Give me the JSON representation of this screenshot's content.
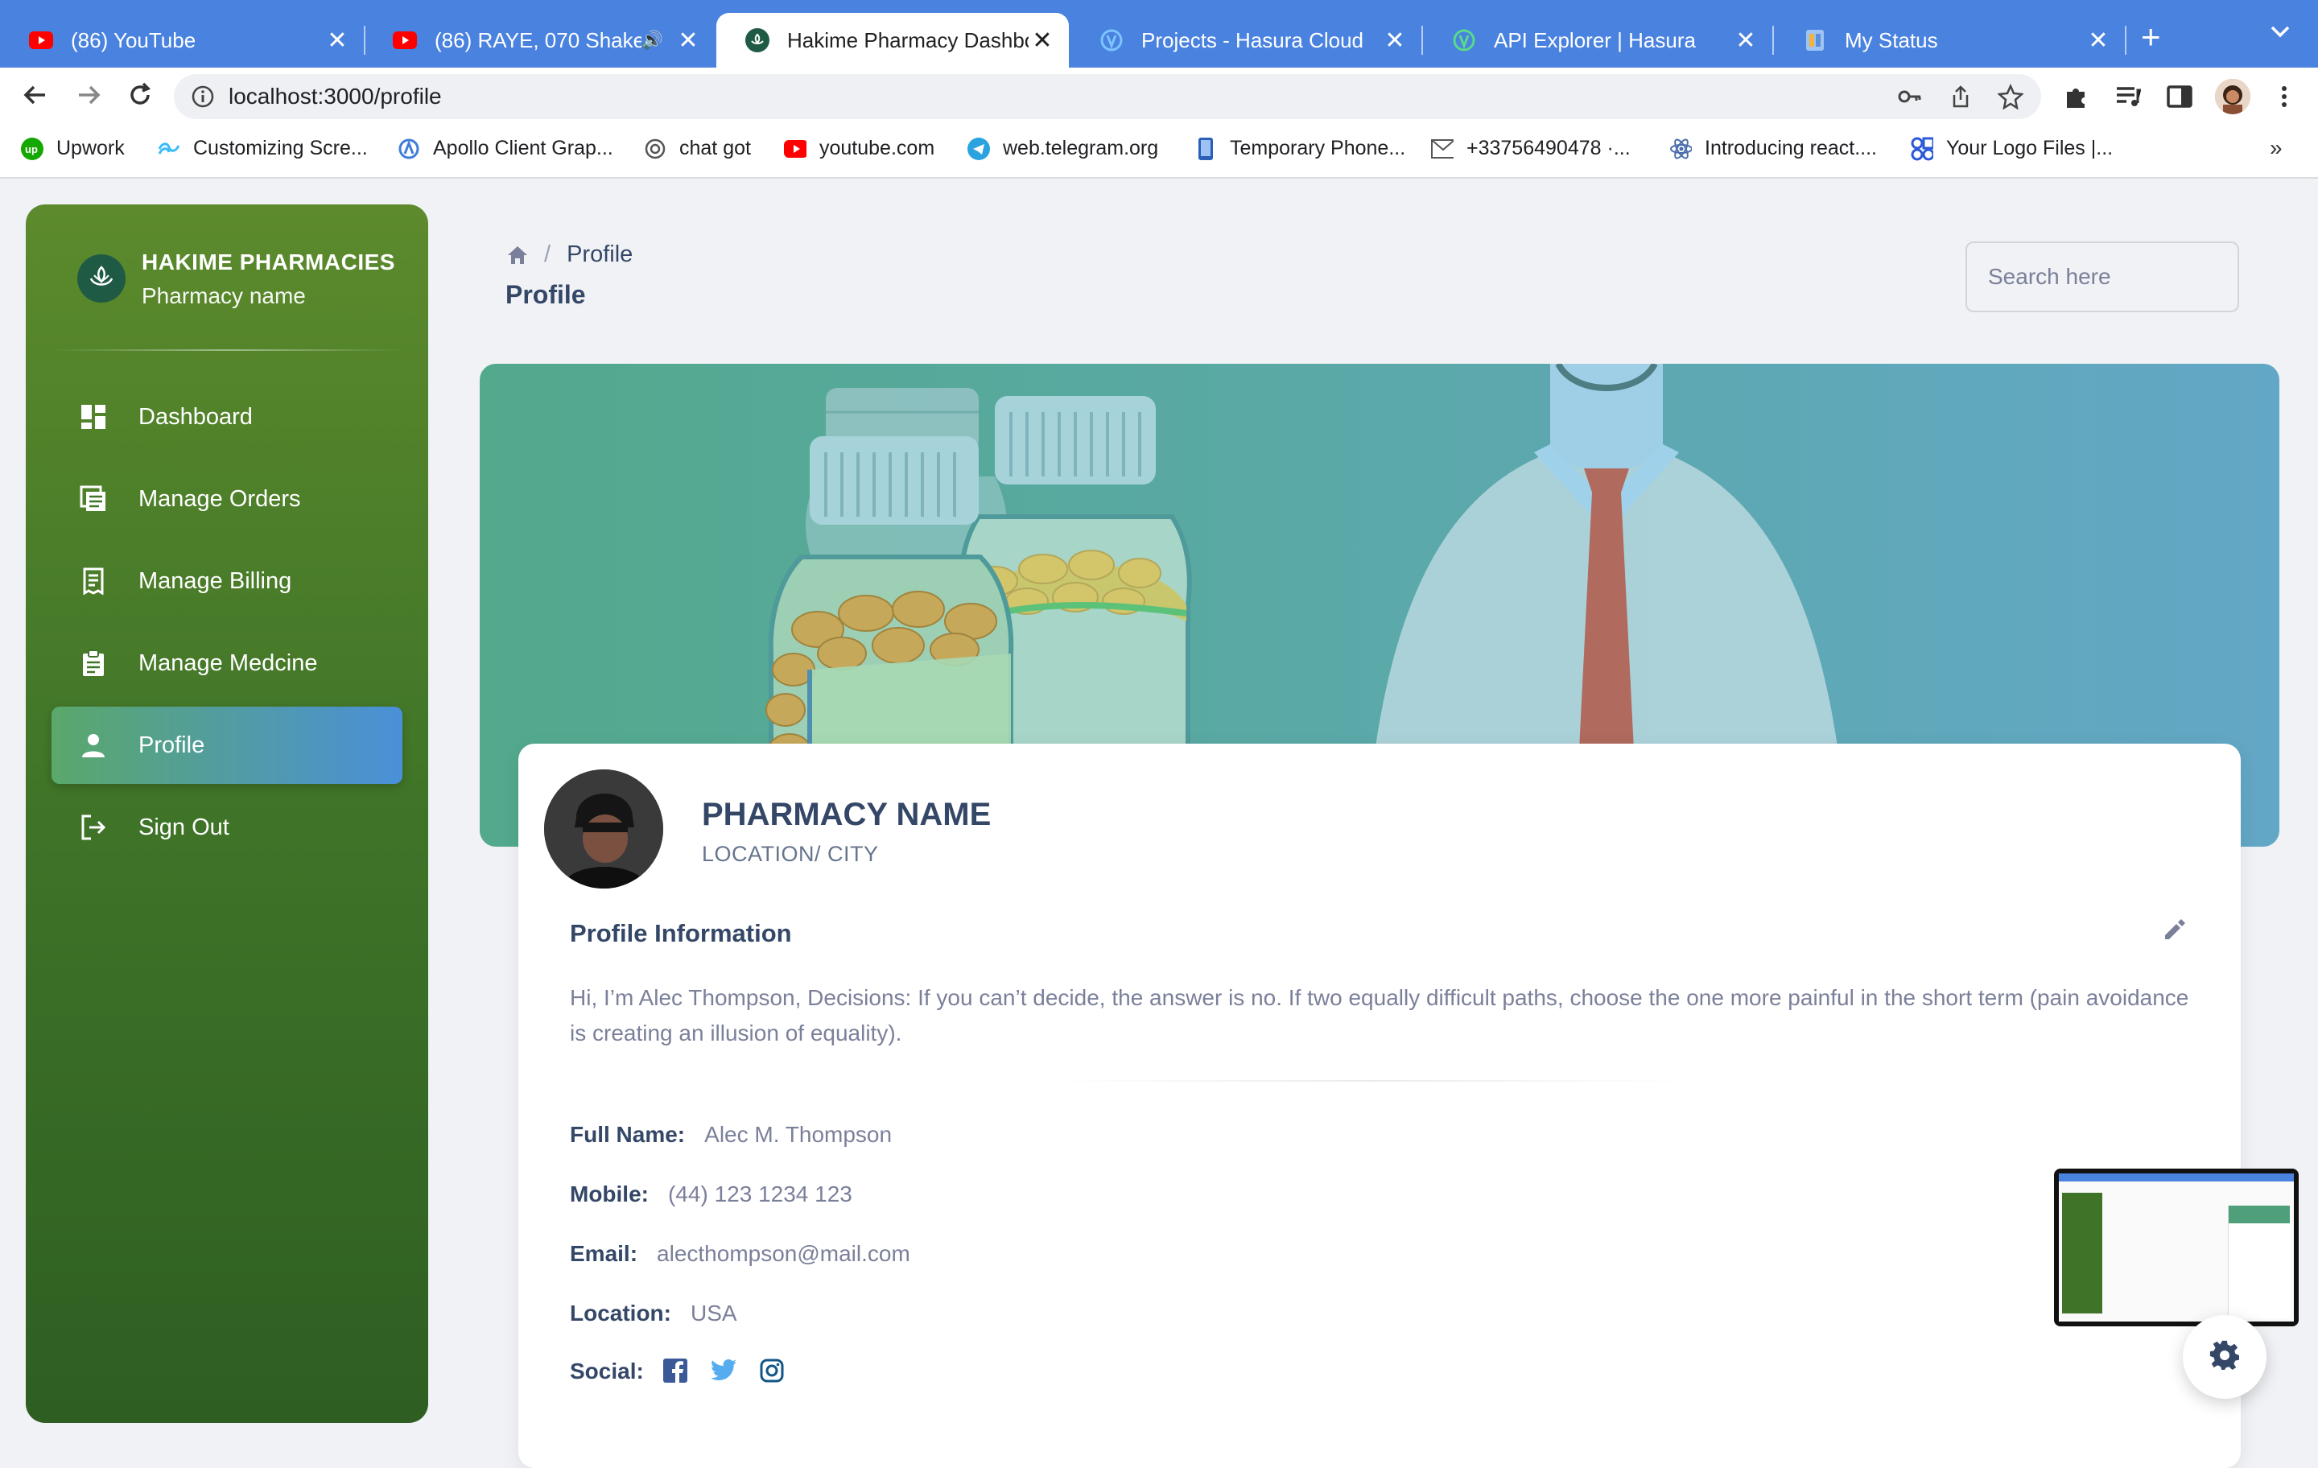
{
  "browser": {
    "tabs": [
      {
        "title": "(86) YouTube",
        "icon": "youtube-icon",
        "active": false
      },
      {
        "title": "(86) RAYE, 070 Shake",
        "icon": "youtube-icon",
        "active": false
      },
      {
        "title": "Hakime Pharmacy Dashboard",
        "icon": "pharmacy-icon",
        "active": true
      },
      {
        "title": "Projects - Hasura Cloud",
        "icon": "hasura-icon",
        "active": false
      },
      {
        "title": "API Explorer | Hasura",
        "icon": "hasura-icon",
        "active": false
      },
      {
        "title": "My Status",
        "icon": "status-icon",
        "active": false
      }
    ],
    "url": "localhost:3000/profile",
    "bookmarks": [
      {
        "label": "Upwork",
        "icon": "upwork-icon"
      },
      {
        "label": "Customizing Scre...",
        "icon": "tailwind-icon"
      },
      {
        "label": "Apollo Client Grap...",
        "icon": "apollo-icon"
      },
      {
        "label": "chat got",
        "icon": "openai-icon"
      },
      {
        "label": "youtube.com",
        "icon": "youtube-icon"
      },
      {
        "label": "web.telegram.org",
        "icon": "telegram-icon"
      },
      {
        "label": "Temporary Phone...",
        "icon": "phone-icon"
      },
      {
        "label": "+33756490478 ·...",
        "icon": "mail-icon"
      },
      {
        "label": "Introducing react....",
        "icon": "react-icon"
      },
      {
        "label": "Your Logo Files |...",
        "icon": "logo-icon"
      }
    ],
    "more": "»"
  },
  "sidebar": {
    "brand_title": "HAKIME PHARMACIES",
    "brand_subtitle": "Pharmacy name",
    "items": [
      {
        "label": "Dashboard",
        "icon": "dashboard-icon",
        "active": false
      },
      {
        "label": "Manage Orders",
        "icon": "orders-icon",
        "active": false
      },
      {
        "label": "Manage Billing",
        "icon": "billing-icon",
        "active": false
      },
      {
        "label": "Manage Medcine",
        "icon": "clipboard-icon",
        "active": false
      },
      {
        "label": "Profile",
        "icon": "person-icon",
        "active": true
      },
      {
        "label": "Sign Out",
        "icon": "signout-icon",
        "active": false
      }
    ]
  },
  "header": {
    "breadcrumb_sep": "/",
    "breadcrumb_current": "Profile",
    "title": "Profile",
    "search_placeholder": "Search here"
  },
  "profile": {
    "name": "PHARMACY NAME",
    "location": "LOCATION/ CITY",
    "section_title": "Profile Information",
    "bio": "Hi, I’m Alec Thompson, Decisions: If you can’t decide, the answer is no. If two equally difficult paths, choose the one more painful in the short term (pain avoidance is creating an illusion of equality).",
    "fields": {
      "full_name_label": "Full Name:",
      "full_name": "Alec M. Thompson",
      "mobile_label": "Mobile:",
      "mobile": "(44) 123 1234 123",
      "email_label": "Email:",
      "email": "alecthompson@mail.com",
      "location_label": "Location:",
      "location": "USA",
      "social_label": "Social:"
    },
    "social": [
      "facebook-icon",
      "twitter-icon",
      "instagram-icon"
    ]
  },
  "colors": {
    "tabbar": "#4a82e0",
    "sidebar_top": "#5c8a2c",
    "sidebar_bottom": "#2e5e22",
    "text_dark": "#344767",
    "text_muted": "#7b809a",
    "facebook": "#3b5998",
    "twitter": "#55acee",
    "instagram": "#125688"
  }
}
